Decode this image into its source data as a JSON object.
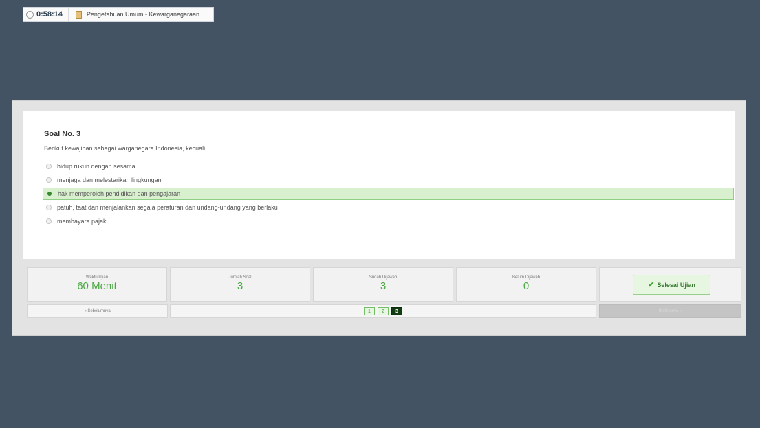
{
  "header": {
    "timer": "0:58:14",
    "subject": "Pengetahuan Umum - Kewarganegaraan"
  },
  "question": {
    "title": "Soal No. 3",
    "text": "Berikut kewajiban sebagai warganegara Indonesia, kecuali....",
    "options": [
      {
        "label": "hidup rukun dengan sesama",
        "selected": false
      },
      {
        "label": "menjaga dan melestarikan lingkungan",
        "selected": false
      },
      {
        "label": "hak memperoleh pendidikan dan pengajaran",
        "selected": true
      },
      {
        "label": "patuh, taat dan menjalankan segala peraturan dan undang-undang yang berlaku",
        "selected": false
      },
      {
        "label": "membayara pajak",
        "selected": false
      }
    ]
  },
  "stats": [
    {
      "label": "Waktu Ujian",
      "value": "60 Menit"
    },
    {
      "label": "Jumlah Soal",
      "value": "3"
    },
    {
      "label": "Sudah Dijawab",
      "value": "3"
    },
    {
      "label": "Belum Dijawab",
      "value": "0"
    }
  ],
  "finish_button": "Selesai Ujian",
  "nav": {
    "prev_label": "« Sebelumnya",
    "next_label": "Berikutnya »",
    "pages": [
      "1",
      "2",
      "3"
    ],
    "current_page": "3"
  },
  "colors": {
    "background": "#435363",
    "accent_green": "#47a83f",
    "selected_option_bg": "#d9f0cf",
    "active_page": "#123b12"
  },
  "icons": {
    "timer": "clock-icon",
    "subject": "book-icon",
    "finish": "check-icon"
  }
}
